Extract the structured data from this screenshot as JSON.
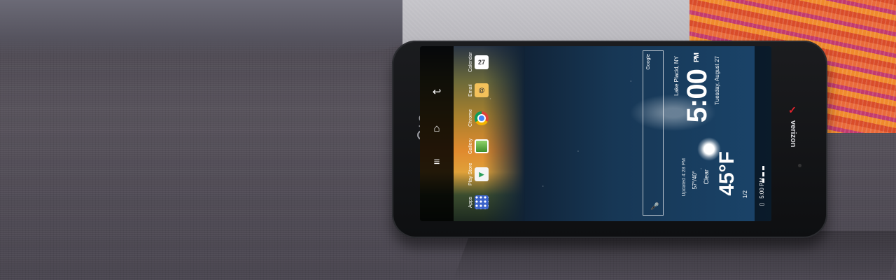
{
  "icons": {
    "nav_back": "back-icon",
    "nav_home": "home-icon",
    "nav_menu": "menu-icon"
  },
  "dock": [
    {
      "label": "Calendar",
      "icon": "calendar-icon",
      "glyph": "27",
      "color": "#ffffff"
    },
    {
      "label": "Email",
      "icon": "email-icon",
      "glyph": "@",
      "color": "#f3c15a"
    },
    {
      "label": "Chrome",
      "icon": "chrome-icon",
      "glyph": "",
      "color": "#e9e9e9"
    },
    {
      "label": "Gallery",
      "icon": "gallery-icon",
      "glyph": "",
      "color": "#6bbf4e"
    },
    {
      "label": "Play Store",
      "icon": "play-store-icon",
      "glyph": "▶",
      "color": "#f5f5f5"
    },
    {
      "label": "Apps",
      "icon": "apps-grid-icon",
      "glyph": "",
      "color": "#3b63c9"
    }
  ],
  "search": {
    "label": "Google"
  },
  "clock": {
    "city": "Lake Placid, NY",
    "time": "5:00",
    "ampm": "PM",
    "date": "Tuesday, August 27"
  },
  "weather": {
    "temp": "45°F",
    "condition": "Clear",
    "hilo": "57°/40°",
    "updated": "Updated 4:28 PM"
  },
  "status": {
    "time": "5:00 PM",
    "page": "1/2"
  },
  "brand": {
    "maker": "LG",
    "carrier": "verizon"
  },
  "colors": {
    "verizon_red": "#e6222d"
  }
}
